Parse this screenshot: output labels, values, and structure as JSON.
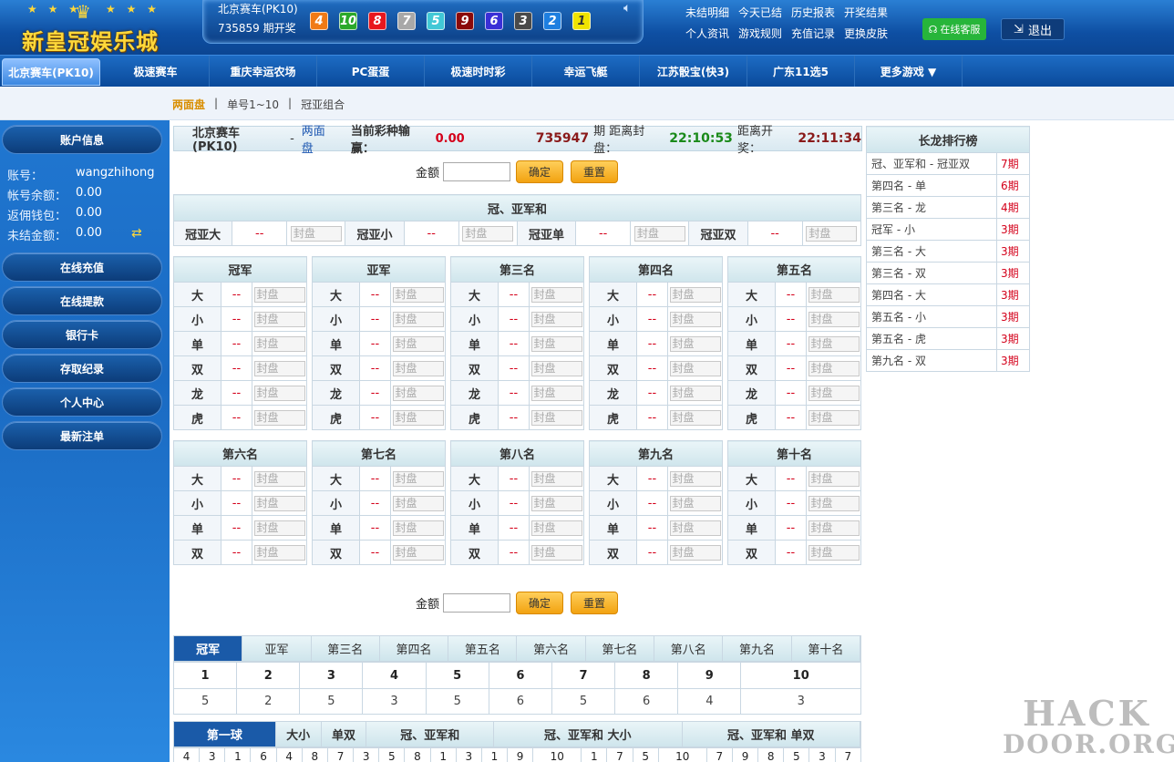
{
  "logo": {
    "text": "新皇冠娱乐城",
    "stars": "★ ★ ★",
    "stars_right": "★ ★ ★"
  },
  "lottery": {
    "name": "北京赛车(PK10)",
    "issue": "735859 期开奖",
    "balls": [
      {
        "n": "4",
        "color": "#f07a16"
      },
      {
        "n": "10",
        "color": "#2ba82b"
      },
      {
        "n": "8",
        "color": "#e8171d"
      },
      {
        "n": "7",
        "color": "#a8a8a8"
      },
      {
        "n": "5",
        "color": "#41c8d6"
      },
      {
        "n": "9",
        "color": "#8a0a0a"
      },
      {
        "n": "6",
        "color": "#3a2fd6"
      },
      {
        "n": "3",
        "color": "#4a4a4a"
      },
      {
        "n": "2",
        "color": "#1e7fe0"
      },
      {
        "n": "1",
        "color": "#f0e300"
      }
    ]
  },
  "toplinks": [
    "未结明细",
    "今天已结",
    "历史报表",
    "开奖结果",
    "个人资讯",
    "游戏规则",
    "充值记录",
    "更换皮肤"
  ],
  "service_label": "在线客服",
  "logout_label": "退出",
  "nav": [
    "北京赛车(PK10)",
    "极速赛车",
    "重庆幸运农场",
    "PC蛋蛋",
    "极速时时彩",
    "幸运飞艇",
    "江苏骰宝(快3)",
    "广东11选5",
    "更多游戏 ▼"
  ],
  "subnav": {
    "items": [
      "两面盘",
      "单号1~10",
      "冠亚组合"
    ],
    "sep": "|"
  },
  "sidebar": {
    "account_title": "账户信息",
    "account": [
      {
        "k": "账号：",
        "v": "wangzhihong"
      },
      {
        "k": "帐号余额：",
        "v": "0.00"
      },
      {
        "k": "返佣钱包：",
        "v": "0.00"
      },
      {
        "k": "未结金额：",
        "v": "0.00"
      }
    ],
    "buttons": [
      "在线充值",
      "在线提款",
      "银行卡",
      "存取纪录",
      "个人中心",
      "最新注单"
    ]
  },
  "info": {
    "game": "北京赛车(PK10)",
    "dash": "-",
    "mode": "两面盘",
    "pl_label": "当前彩种输赢：",
    "pl": "0.00",
    "issue": "735947",
    "period_label": "期 距离封盘：",
    "close_time": "22:10:53",
    "open_label": "距离开奖：",
    "open_time": "22:11:34"
  },
  "amount": {
    "label": "金额",
    "confirm": "确定",
    "reset": "重置"
  },
  "sum_table": {
    "title": "冠、亚军和",
    "cells": [
      "冠亚大",
      "冠亚小",
      "冠亚单",
      "冠亚双"
    ],
    "odds": "--",
    "sealed": "封盘"
  },
  "groups1": {
    "titles": [
      "冠军",
      "亚军",
      "第三名",
      "第四名",
      "第五名"
    ],
    "rows": [
      "大",
      "小",
      "单",
      "双",
      "龙",
      "虎"
    ]
  },
  "groups2": {
    "titles": [
      "第六名",
      "第七名",
      "第八名",
      "第九名",
      "第十名"
    ],
    "rows": [
      "大",
      "小",
      "单",
      "双"
    ]
  },
  "rank": {
    "title": "长龙排行榜",
    "rows": [
      {
        "k": "冠、亚军和 - 冠亚双",
        "v": "7期"
      },
      {
        "k": "第四名 - 单",
        "v": "6期"
      },
      {
        "k": "第三名 - 龙",
        "v": "4期"
      },
      {
        "k": "冠军 - 小",
        "v": "3期"
      },
      {
        "k": "第三名 - 大",
        "v": "3期"
      },
      {
        "k": "第三名 - 双",
        "v": "3期"
      },
      {
        "k": "第四名 - 大",
        "v": "3期"
      },
      {
        "k": "第五名 - 小",
        "v": "3期"
      },
      {
        "k": "第五名 - 虎",
        "v": "3期"
      },
      {
        "k": "第九名 - 双",
        "v": "3期"
      }
    ]
  },
  "stat_tabs": [
    "冠军",
    "亚军",
    "第三名",
    "第四名",
    "第五名",
    "第六名",
    "第七名",
    "第八名",
    "第九名",
    "第十名"
  ],
  "stat_table": {
    "nums": [
      "1",
      "2",
      "3",
      "4",
      "5",
      "6",
      "7",
      "8",
      "9",
      "10"
    ],
    "counts": [
      "5",
      "2",
      "5",
      "3",
      "5",
      "6",
      "5",
      "6",
      "4",
      "3"
    ]
  },
  "trend_tabs": [
    "第一球",
    "大小",
    "单双",
    "冠、亚军和",
    "冠、亚军和 大小",
    "冠、亚军和 单双"
  ],
  "trend_row": [
    "4",
    "3",
    "1",
    "6",
    "4",
    "8",
    "7",
    "3",
    "5",
    "8",
    "1",
    "3",
    "1",
    "9",
    "10",
    "1",
    "7",
    "5",
    "10",
    "7",
    "9",
    "8",
    "5",
    "3",
    "7"
  ],
  "watermark": {
    "line1": "HACK",
    "line2": "DOOR.ORG"
  }
}
